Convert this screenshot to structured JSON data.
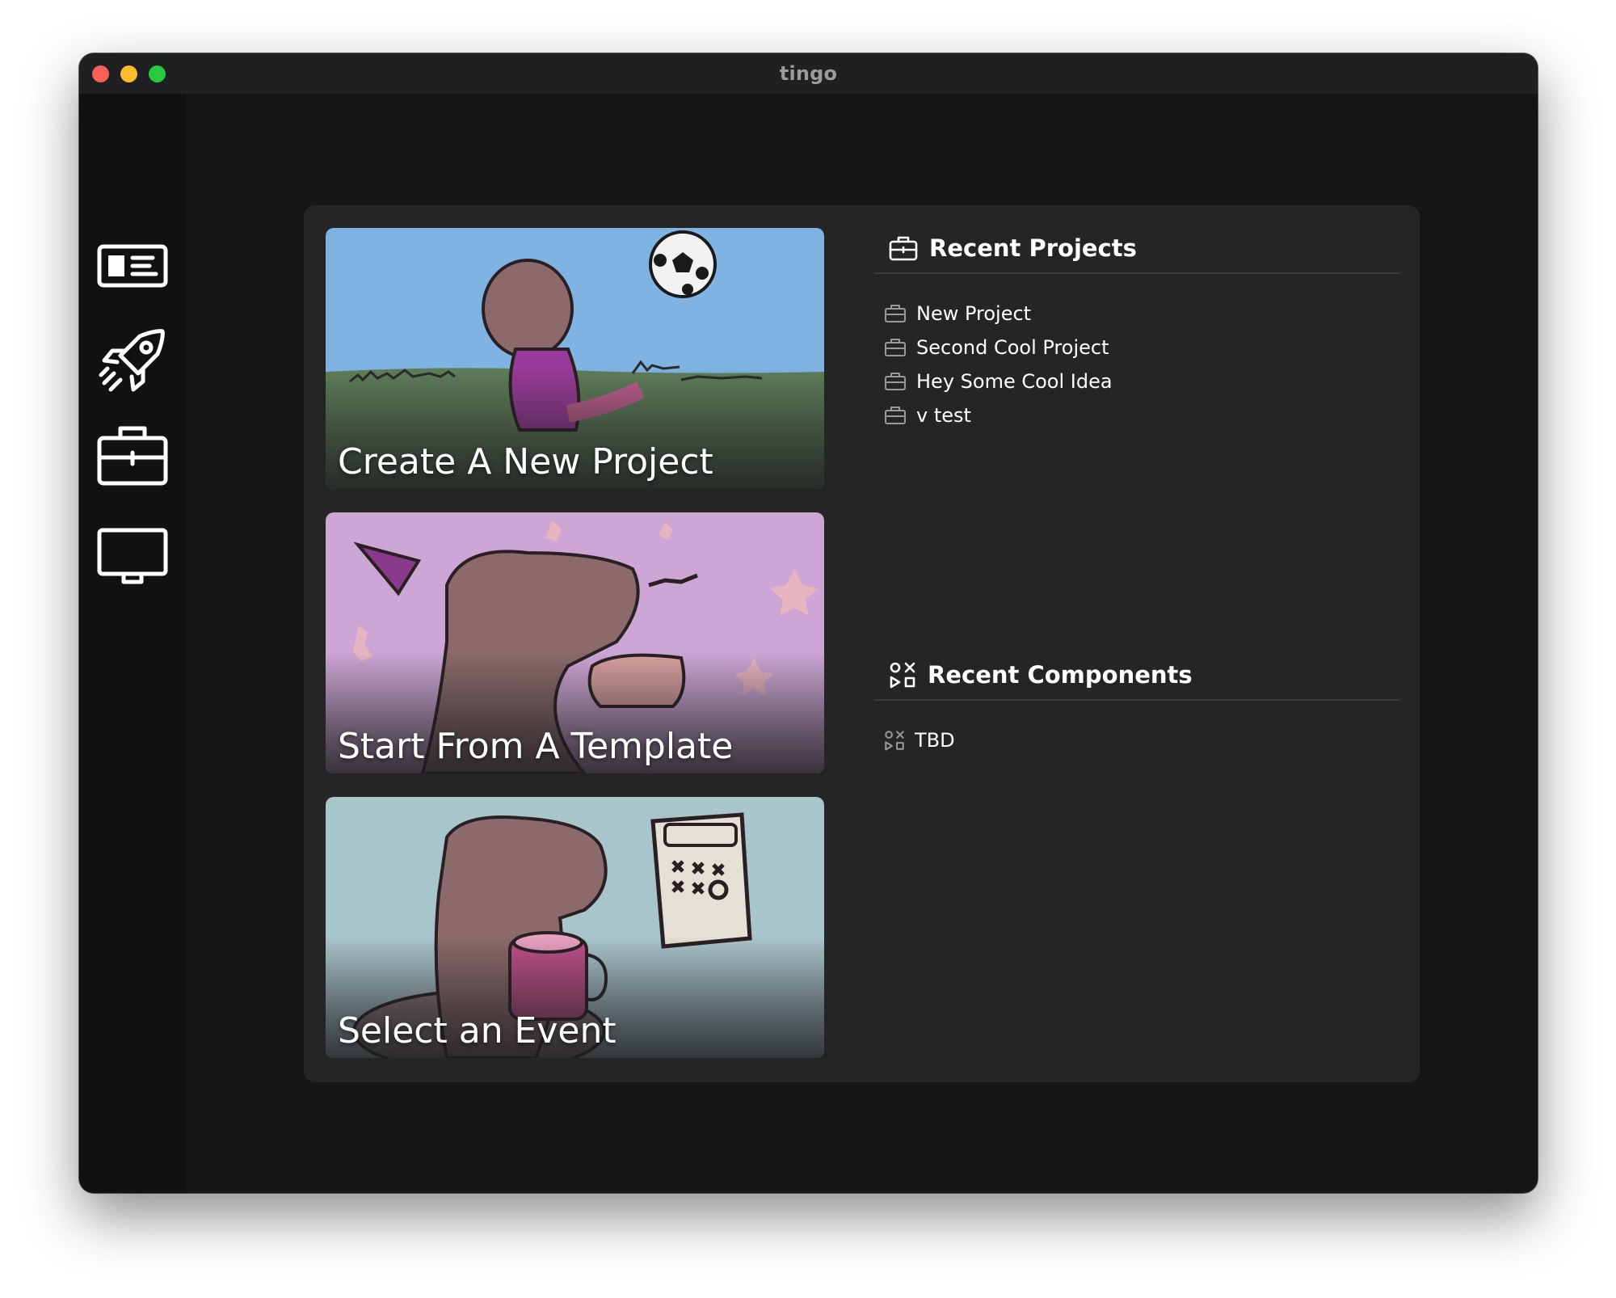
{
  "window": {
    "title": "tingo"
  },
  "sidebar": {
    "items": [
      {
        "name": "dashboard",
        "icon": "id-card-icon"
      },
      {
        "name": "launch",
        "icon": "rocket-icon"
      },
      {
        "name": "projects",
        "icon": "briefcase-icon"
      },
      {
        "name": "display",
        "icon": "monitor-icon"
      }
    ]
  },
  "cards": [
    {
      "label": "Create A New Project",
      "bg": "#7fb3e2",
      "ground": "#5e7d5a"
    },
    {
      "label": "Start From A Template",
      "bg": "#cda6d5"
    },
    {
      "label": "Select an Event",
      "bg": "#a9c5cc"
    }
  ],
  "recent_projects": {
    "title": "Recent Projects",
    "items": [
      "New Project",
      "Second Cool Project",
      "Hey Some Cool Idea",
      "v test"
    ]
  },
  "recent_components": {
    "title": "Recent Components",
    "items": [
      "TBD"
    ]
  }
}
